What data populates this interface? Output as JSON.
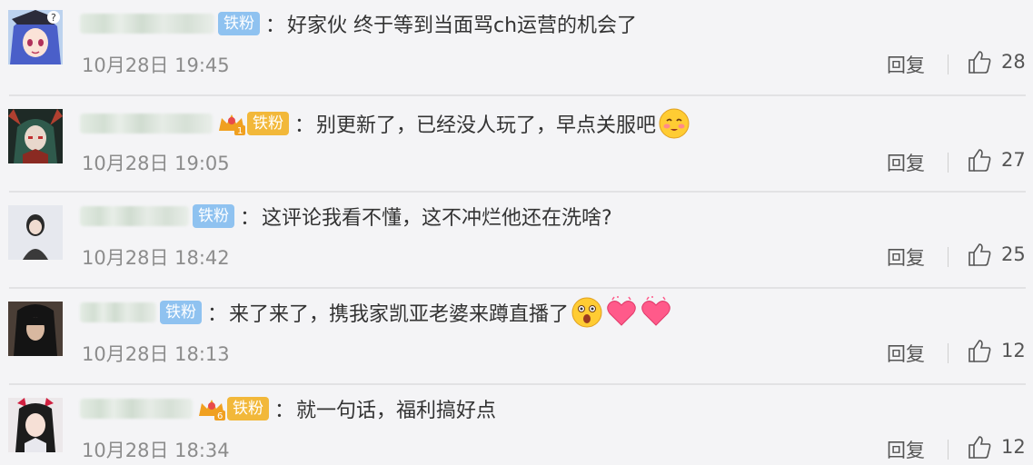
{
  "ui": {
    "reply_label": "回复",
    "badge_label": "铁粉",
    "colon": "："
  },
  "comments": [
    {
      "text": "好家伙 终于等到当面骂ch运营的机会了",
      "time": "10月28日 19:45",
      "likes": "28",
      "avatar_icon": "anime-girl-avatar",
      "crown": false,
      "crown_level": "",
      "emojis": []
    },
    {
      "text": "别更新了，已经没人玩了，早点关服吧",
      "time": "10月28日 19:05",
      "likes": "27",
      "avatar_icon": "dark-character-avatar",
      "crown": true,
      "crown_level": "1",
      "emojis": [
        "blush-face-emoji"
      ]
    },
    {
      "text": "这评论我看不懂，这不冲烂他还在洗啥?",
      "time": "10月28日 18:42",
      "likes": "25",
      "avatar_icon": "photo-avatar",
      "crown": false,
      "crown_level": "",
      "emojis": []
    },
    {
      "text": "来了来了，携我家凯亚老婆来蹲直播了",
      "time": "10月28日 18:13",
      "likes": "12",
      "avatar_icon": "dark-hair-avatar",
      "crown": false,
      "crown_level": "",
      "emojis": [
        "surprised-face-emoji",
        "heart-emoji",
        "heart-emoji"
      ]
    },
    {
      "text": "就一句话，福利搞好点",
      "time": "10月28日 18:34",
      "likes": "12",
      "avatar_icon": "cosplay-avatar",
      "crown": true,
      "crown_level": "6",
      "emojis": []
    }
  ],
  "colors": {
    "background": "#f4f4f6",
    "badge_blue": "#8fc2f0",
    "badge_gold": "#f2b83a",
    "time_gray": "#8c8c8c"
  }
}
